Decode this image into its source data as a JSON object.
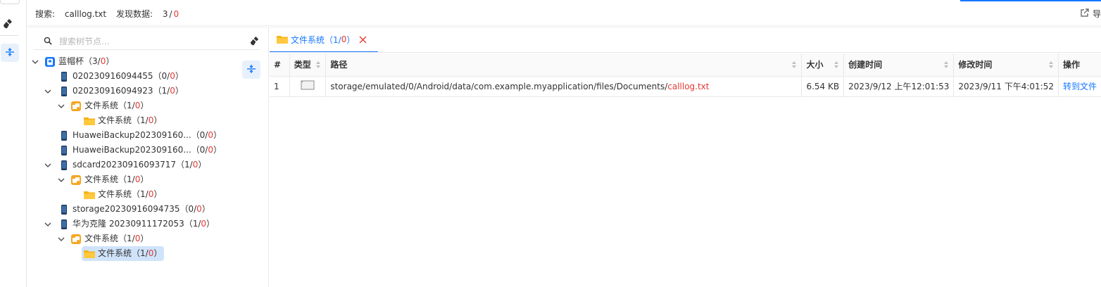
{
  "topbar": {
    "search_label": "搜索:",
    "search_value": "calllog.txt",
    "found_label": "发现数据:",
    "found_count": "3",
    "found_sep": "/",
    "found_red": "0",
    "export_label": "导"
  },
  "tree": {
    "search_placeholder": "搜索树节点...",
    "nodes": [
      {
        "label": "蓝帽杯",
        "count_open": "（3/",
        "count_red": "0",
        "count_close": "）"
      },
      {
        "label": "020230916094455",
        "count_open": "（0/",
        "count_red": "0",
        "count_close": "）"
      },
      {
        "label": "020230916094923",
        "count_open": "（1/",
        "count_red": "0",
        "count_close": "）"
      },
      {
        "label": "文件系统",
        "count_open": "（1/",
        "count_red": "0",
        "count_close": "）"
      },
      {
        "label": "文件系统",
        "count_open": "（1/",
        "count_red": "0",
        "count_close": "）"
      },
      {
        "label": "HuaweiBackup202309160...",
        "count_open": "（0/",
        "count_red": "0",
        "count_close": "）"
      },
      {
        "label": "HuaweiBackup202309160...",
        "count_open": "（0/",
        "count_red": "0",
        "count_close": "）"
      },
      {
        "label": "sdcard20230916093717",
        "count_open": "（1/",
        "count_red": "0",
        "count_close": "）"
      },
      {
        "label": "文件系统",
        "count_open": "（1/",
        "count_red": "0",
        "count_close": "）"
      },
      {
        "label": "文件系统",
        "count_open": "（1/",
        "count_red": "0",
        "count_close": "）"
      },
      {
        "label": "storage20230916094735",
        "count_open": "（0/",
        "count_red": "0",
        "count_close": "）"
      },
      {
        "label": "华为克隆 20230911172053",
        "count_open": "（1/",
        "count_red": "0",
        "count_close": "）"
      },
      {
        "label": "文件系统",
        "count_open": "（1/",
        "count_red": "0",
        "count_close": "）"
      },
      {
        "label": "文件系统",
        "count_open": "（1/",
        "count_red": "0",
        "count_close": "）"
      }
    ]
  },
  "tab": {
    "label": "文件系统",
    "count_open": "（1/",
    "count_red": "0",
    "count_close": "）"
  },
  "table": {
    "headers": [
      "#",
      "类型",
      "路径",
      "大小",
      "创建时间",
      "修改时间",
      "操作"
    ],
    "rows": [
      {
        "index": "1",
        "path_prefix": "storage/emulated/0/Android/data/com.example.myapplication/files/Documents/",
        "path_match": "calllog.txt",
        "size": "6.54 KB",
        "created": "2023/9/12 上午12:01:53",
        "modified": "2023/9/11 下午4:01:52",
        "action": "转到文件"
      }
    ]
  },
  "colors": {
    "accent": "#1677ff",
    "highlight_red": "#e53935",
    "folder": "#f5b316",
    "selected_bg": "#cfe3fb"
  }
}
